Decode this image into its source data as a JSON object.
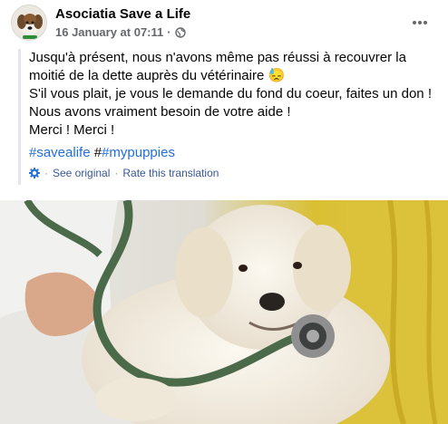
{
  "post": {
    "page_name": "Asociatia Save a Life",
    "timestamp": "16 January at 07:11",
    "separator": "·",
    "audience_icon": "globe-icon",
    "more_icon": "more-horizontal-icon",
    "lines": [
      "Jusqu'à présent, nous n'avons même pas réussi à recouvrer la moitié de la dette auprès du vétérinaire 😓",
      "S'il vous plait, je vous le demande du fond du coeur, faites un don !",
      "Nous avons vraiment besoin de votre aide !",
      "Merci ! Merci !"
    ],
    "hashtag_1": "#savealife",
    "hashtag_sep": "#",
    "hashtag_2": "#mypuppies",
    "translation": {
      "icon": "gear-icon",
      "see_original": "See original",
      "dot": "·",
      "rate": "Rate this translation"
    },
    "photo_icon": "puppy-with-stethoscope-photo"
  },
  "colors": {
    "link": "#216fdb",
    "meta": "#65676b",
    "photo_bg": "#d9c33a"
  }
}
